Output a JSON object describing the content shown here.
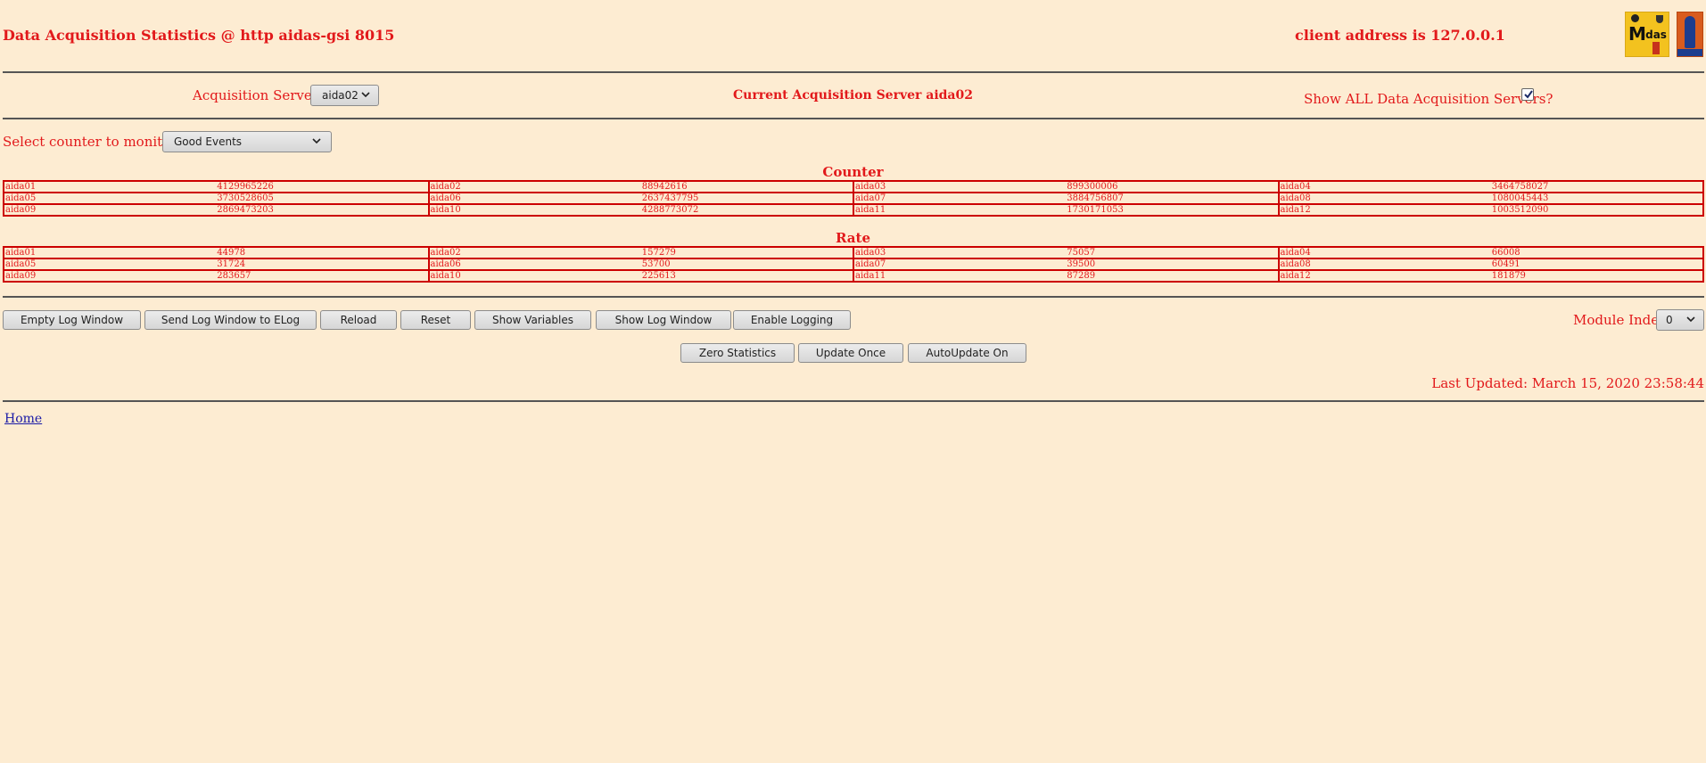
{
  "header": {
    "title": "Data Acquisition Statistics @ http aidas-gsi 8015",
    "client_address": "client address is 127.0.0.1",
    "logos": [
      "Midas",
      "TRIUMF"
    ]
  },
  "server_row": {
    "acq_servers_label": "Acquisition Servers",
    "acq_servers_selected": "aida02",
    "current_server": "Current Acquisition Server aida02",
    "show_all_label": "Show ALL Data Acquisition Servers?",
    "show_all_checked": true
  },
  "counter_select": {
    "label": "Select counter to monitor",
    "selected": "Good Events"
  },
  "counter_table": {
    "title": "Counter",
    "rows": [
      [
        [
          "aida01",
          "4129965226"
        ],
        [
          "aida02",
          "88942616"
        ],
        [
          "aida03",
          "899300006"
        ],
        [
          "aida04",
          "3464758027"
        ]
      ],
      [
        [
          "aida05",
          "3730528605"
        ],
        [
          "aida06",
          "2637437795"
        ],
        [
          "aida07",
          "3884756807"
        ],
        [
          "aida08",
          "1080045443"
        ]
      ],
      [
        [
          "aida09",
          "2869473203"
        ],
        [
          "aida10",
          "4288773072"
        ],
        [
          "aida11",
          "1730171053"
        ],
        [
          "aida12",
          "1003512090"
        ]
      ]
    ]
  },
  "rate_table": {
    "title": "Rate",
    "rows": [
      [
        [
          "aida01",
          "44978"
        ],
        [
          "aida02",
          "157279"
        ],
        [
          "aida03",
          "75057"
        ],
        [
          "aida04",
          "66008"
        ]
      ],
      [
        [
          "aida05",
          "31724"
        ],
        [
          "aida06",
          "53700"
        ],
        [
          "aida07",
          "39500"
        ],
        [
          "aida08",
          "60491"
        ]
      ],
      [
        [
          "aida09",
          "283657"
        ],
        [
          "aida10",
          "225613"
        ],
        [
          "aida11",
          "87289"
        ],
        [
          "aida12",
          "181879"
        ]
      ]
    ]
  },
  "buttons": {
    "empty_log": "Empty Log Window",
    "send_log": "Send Log Window to ELog",
    "reload": "Reload",
    "reset": "Reset",
    "show_variables": "Show Variables",
    "show_log": "Show Log Window",
    "enable_logging": "Enable Logging",
    "zero_stats": "Zero Statistics",
    "update_once": "Update Once",
    "autoupdate": "AutoUpdate On"
  },
  "module_index": {
    "label": "Module Index",
    "selected": "0"
  },
  "last_updated": "Last Updated: March 15, 2020 23:58:44",
  "footer": {
    "home_link": "Home"
  },
  "colors": {
    "background": "#fdecd2",
    "text": "#e2191b",
    "table_border": "#cc0000"
  }
}
